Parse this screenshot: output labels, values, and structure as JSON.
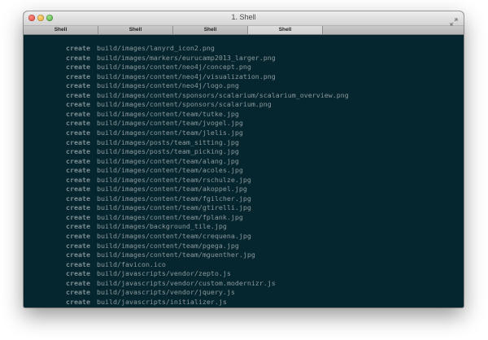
{
  "window": {
    "title": "1. Shell"
  },
  "tabs": [
    {
      "label": "Shell"
    },
    {
      "label": "Shell"
    },
    {
      "label": "Shell"
    },
    {
      "label": "Shell"
    }
  ],
  "terminal": {
    "status_word": "create",
    "lines": [
      {
        "status": "create",
        "path": "build/images/lanyrd_icon2.png"
      },
      {
        "status": "create",
        "path": "build/images/markers/eurucamp2013_larger.png"
      },
      {
        "status": "create",
        "path": "build/images/content/neo4j/concept.png"
      },
      {
        "status": "create",
        "path": "build/images/content/neo4j/visualization.png"
      },
      {
        "status": "create",
        "path": "build/images/content/neo4j/logo.png"
      },
      {
        "status": "create",
        "path": "build/images/content/sponsors/scalarium/scalarium_overview.png"
      },
      {
        "status": "create",
        "path": "build/images/content/sponsors/scalarium.png"
      },
      {
        "status": "create",
        "path": "build/images/content/team/tutke.jpg"
      },
      {
        "status": "create",
        "path": "build/images/content/team/jvogel.jpg"
      },
      {
        "status": "create",
        "path": "build/images/content/team/jlelis.jpg"
      },
      {
        "status": "create",
        "path": "build/images/posts/team_sitting.jpg"
      },
      {
        "status": "create",
        "path": "build/images/posts/team_picking.jpg"
      },
      {
        "status": "create",
        "path": "build/images/content/team/alang.jpg"
      },
      {
        "status": "create",
        "path": "build/images/content/team/acoles.jpg"
      },
      {
        "status": "create",
        "path": "build/images/content/team/rschulze.jpg"
      },
      {
        "status": "create",
        "path": "build/images/content/team/akoppel.jpg"
      },
      {
        "status": "create",
        "path": "build/images/content/team/fgilcher.jpg"
      },
      {
        "status": "create",
        "path": "build/images/content/team/gtirelli.jpg"
      },
      {
        "status": "create",
        "path": "build/images/content/team/fplank.jpg"
      },
      {
        "status": "create",
        "path": "build/images/background_tile.jpg"
      },
      {
        "status": "create",
        "path": "build/images/content/team/crequena.jpg"
      },
      {
        "status": "create",
        "path": "build/images/content/team/pgega.jpg"
      },
      {
        "status": "create",
        "path": "build/images/content/team/mguenther.jpg"
      },
      {
        "status": "create",
        "path": "build/favicon.ico"
      },
      {
        "status": "create",
        "path": "build/javascripts/vendor/zepto.js"
      },
      {
        "status": "create",
        "path": "build/javascripts/vendor/custom.modernizr.js"
      },
      {
        "status": "create",
        "path": "build/javascripts/vendor/jquery.js"
      },
      {
        "status": "create",
        "path": "build/javascripts/initializer.js"
      }
    ]
  },
  "colors": {
    "terminal_background": "#06262f",
    "terminal_text": "#8a989c",
    "cursor": "#f2f2f2"
  }
}
